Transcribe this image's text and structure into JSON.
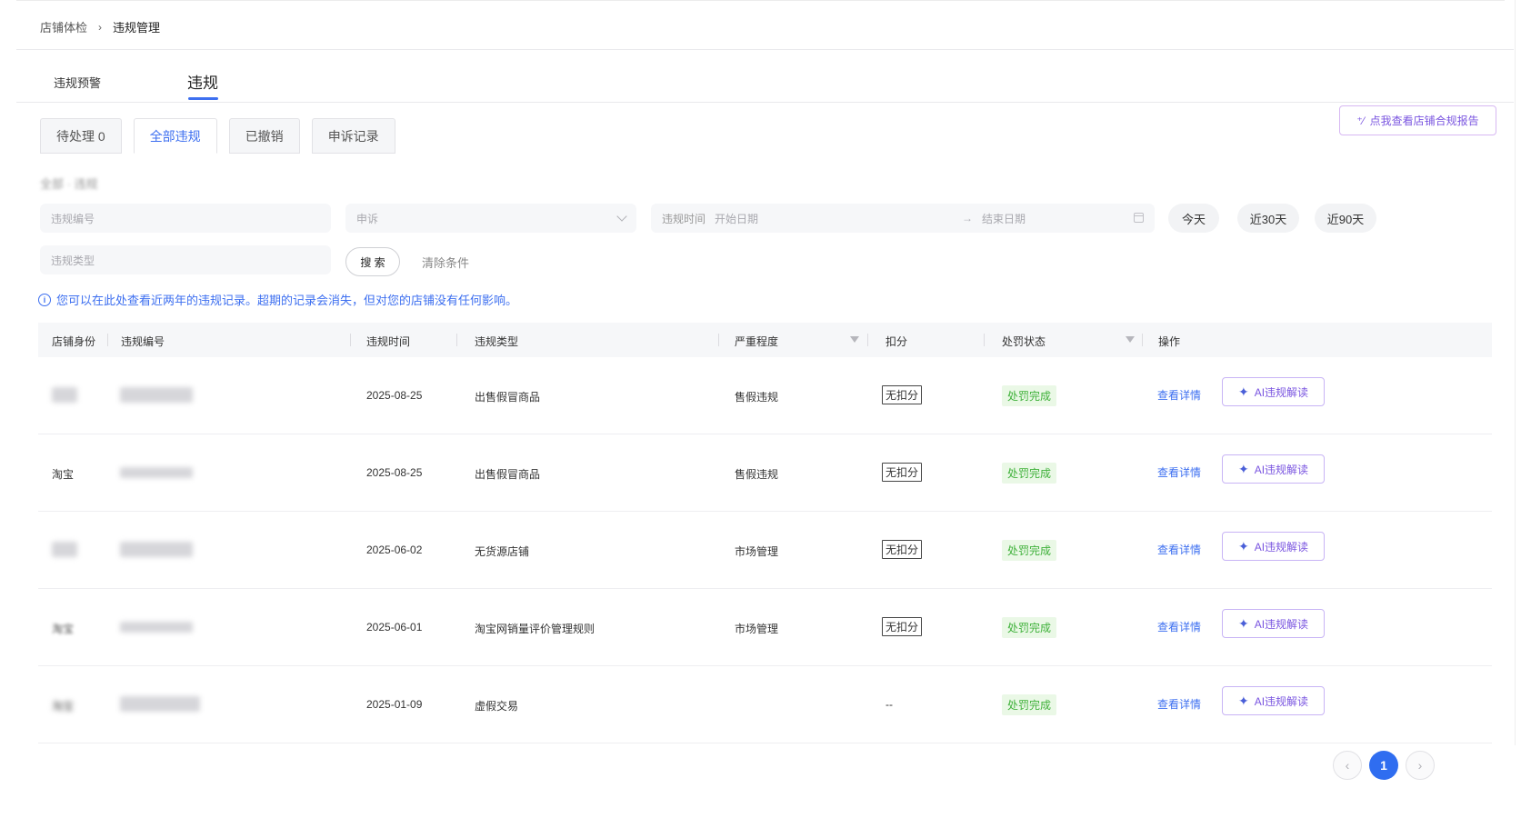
{
  "breadcrumb": {
    "parent": "店铺体检",
    "separator": "›",
    "current": "违规管理"
  },
  "main_tabs": [
    {
      "label": "违规预警",
      "active": false
    },
    {
      "label": "违规",
      "active": true
    }
  ],
  "report_button": {
    "label": "点我查看店铺合规报告",
    "icon": "sparkle-icon"
  },
  "sub_tabs": [
    {
      "label": "待处理 0",
      "active": false
    },
    {
      "label": "全部违规",
      "active": true
    },
    {
      "label": "已撤销",
      "active": false
    },
    {
      "label": "申诉记录",
      "active": false
    }
  ],
  "blurred_label": "全部 · 违规",
  "filters": {
    "code_placeholder": "违规编号",
    "appeal_placeholder": "申诉",
    "date_label": "违规时间",
    "start_placeholder": "开始日期",
    "end_placeholder": "结束日期",
    "date_arrow": "→",
    "type_placeholder": "违规类型",
    "quick_ranges": [
      "今天",
      "近30天",
      "近90天"
    ],
    "search_label": "搜 索",
    "clear_label": "清除条件"
  },
  "notice": {
    "icon": "info-icon",
    "text": "您可以在此处查看近两年的违规记录。超期的记录会消失，但对您的店铺没有任何影响。"
  },
  "table": {
    "headers": {
      "identity": "店铺身份",
      "code": "违规编号",
      "time": "违规时间",
      "type": "违规类型",
      "severity": "严重程度",
      "deduct": "扣分",
      "status": "处罚状态",
      "action": "操作"
    },
    "rows": [
      {
        "identity": "",
        "time": "2025-08-25",
        "type": "出售假冒商品",
        "severity": "售假违规",
        "deduct": "无扣分",
        "status": "处罚完成",
        "detail": "查看详情",
        "ai": "AI违规解读"
      },
      {
        "identity": "淘宝",
        "time": "2025-08-25",
        "type": "出售假冒商品",
        "severity": "售假违规",
        "deduct": "无扣分",
        "status": "处罚完成",
        "detail": "查看详情",
        "ai": "AI违规解读"
      },
      {
        "identity": "",
        "time": "2025-06-02",
        "type": "无货源店铺",
        "severity": "市场管理",
        "deduct": "无扣分",
        "status": "处罚完成",
        "detail": "查看详情",
        "ai": "AI违规解读"
      },
      {
        "identity": "淘宝",
        "time": "2025-06-01",
        "type": "淘宝网销量评价管理规则",
        "severity": "市场管理",
        "deduct": "无扣分",
        "status": "处罚完成",
        "detail": "查看详情",
        "ai": "AI违规解读"
      },
      {
        "identity": "淘宝",
        "time": "2025-01-09",
        "type": "虚假交易",
        "severity": "",
        "deduct": "--",
        "status": "处罚完成",
        "detail": "查看详情",
        "ai": "AI违规解读"
      }
    ]
  },
  "pagination": {
    "prev": "‹",
    "current": "1",
    "next": "›"
  },
  "colors": {
    "accent": "#3d6ff0",
    "ai_purple": "#7a55e0",
    "success": "#3fb13a"
  }
}
